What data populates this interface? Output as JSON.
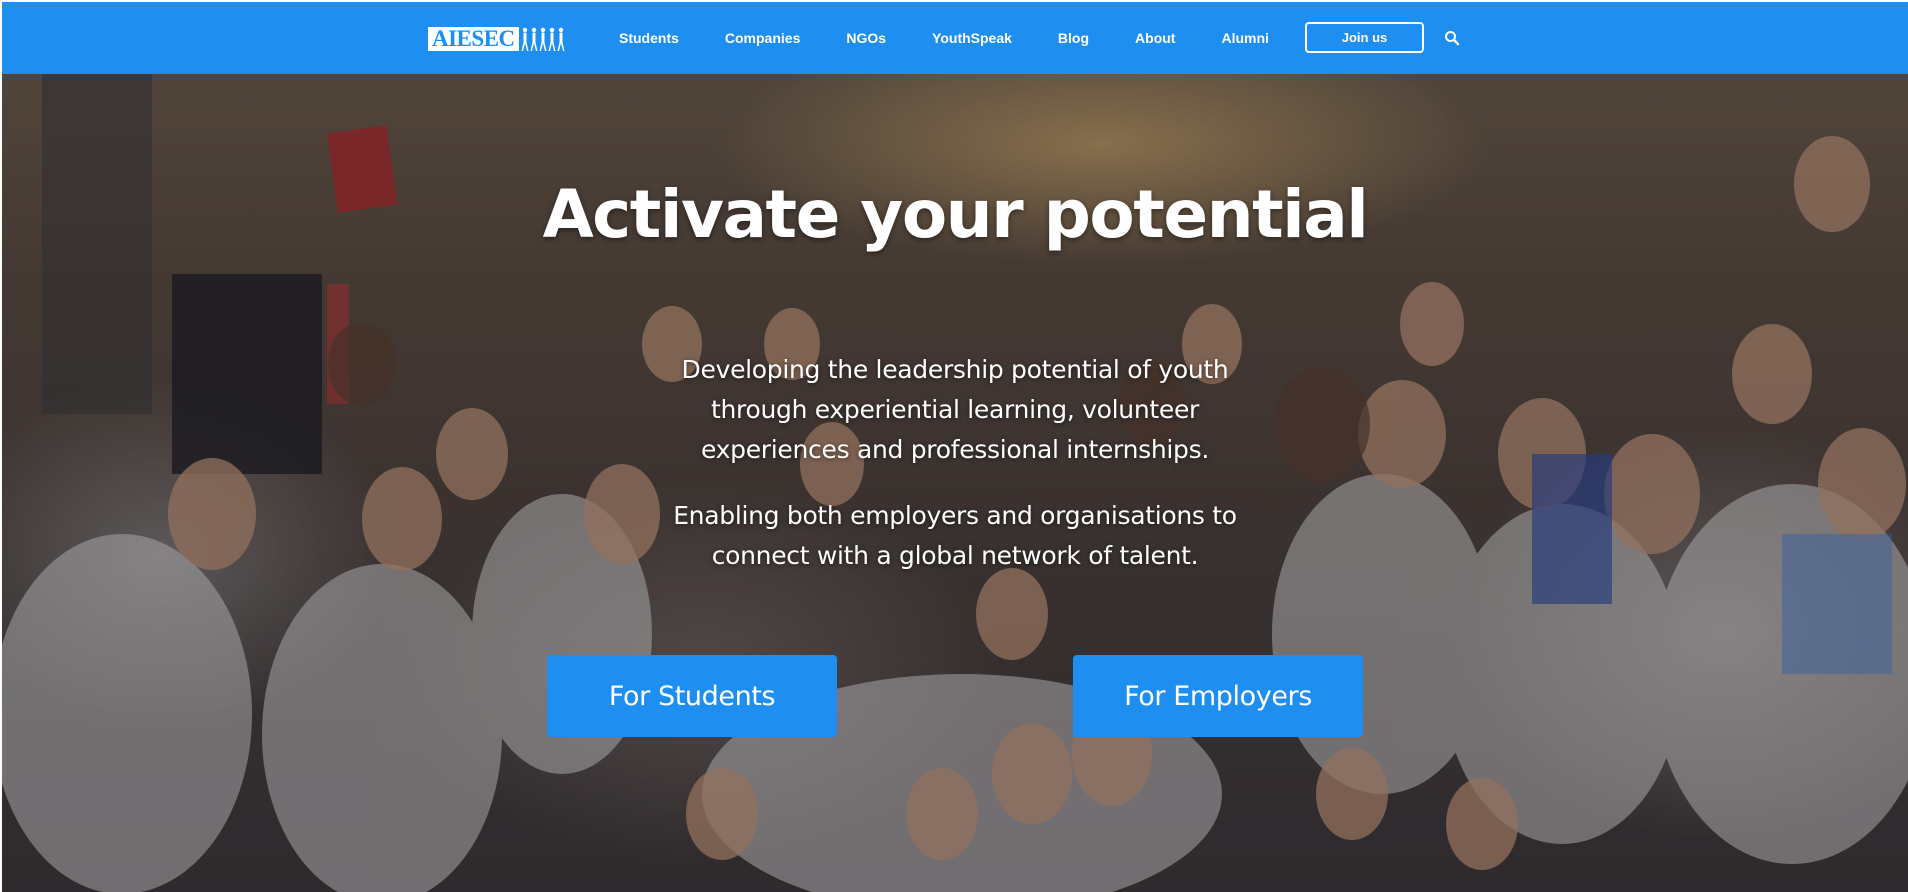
{
  "brand": {
    "logo_text": "AIESEC",
    "logo_icon": "people-figures-icon",
    "color": "#1f8ef1"
  },
  "nav": {
    "items": [
      {
        "label": "Students"
      },
      {
        "label": "Companies"
      },
      {
        "label": "NGOs"
      },
      {
        "label": "YouthSpeak"
      },
      {
        "label": "Blog"
      },
      {
        "label": "About"
      },
      {
        "label": "Alumni"
      }
    ],
    "join_label": "Join us",
    "search_icon": "search-icon"
  },
  "hero": {
    "title": "Activate your potential",
    "paragraph1": "Developing the leadership potential of youth through experiential learning, volunteer experiences and professional internships.",
    "paragraph2": "Enabling both employers and organisations to connect with a global network of talent.",
    "cta_students": "For Students",
    "cta_employers": "For Employers",
    "background_image": "crowd-photo"
  }
}
